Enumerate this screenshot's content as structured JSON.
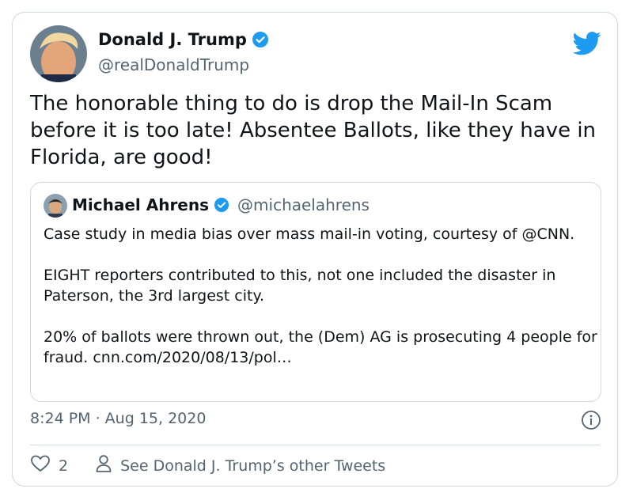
{
  "tweet": {
    "author_name": "Donald J. Trump",
    "author_handle": "@realDonaldTrump",
    "text": "The honorable thing to do is drop the Mail-In Scam before it is too late! Absentee Ballots, like they have in Florida, are good!",
    "timestamp": "8:24 PM · Aug 15, 2020",
    "like_count": "2",
    "other_tweets_label": "See Donald J. Trump’s other Tweets"
  },
  "quote": {
    "author_name": "Michael Ahrens",
    "author_handle": "@michaelahrens",
    "text": "Case study in media bias over mass mail-in voting, courtesy of @CNN.\n\nEIGHT reporters contributed to this, not one included the disaster in Paterson, the 3rd largest city.\n\n20% of ballots were thrown out, the (Dem) AG is prosecuting 4 people for fraud. cnn.com/2020/08/13/pol…"
  },
  "icons": [
    "verified-badge-icon",
    "twitter-bird-icon",
    "info-icon",
    "heart-icon",
    "user-icon"
  ],
  "colors": {
    "twitter_blue": "#1d9bf0",
    "secondary_text": "#536471",
    "border": "#cfd9de"
  }
}
